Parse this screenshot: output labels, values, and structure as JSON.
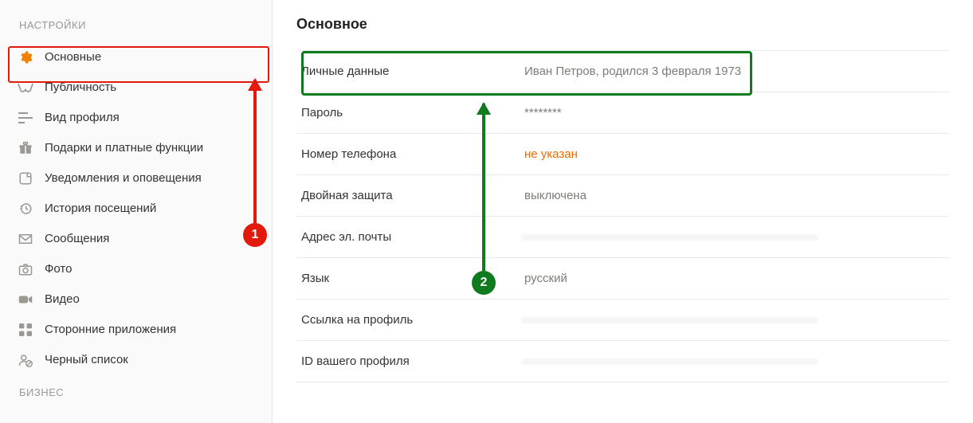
{
  "sidebar": {
    "heading1": "НАСТРОЙКИ",
    "heading2": "БИЗНЕС",
    "items": [
      {
        "label": "Основные",
        "icon": "gear"
      },
      {
        "label": "Публичность",
        "icon": "glasses"
      },
      {
        "label": "Вид профиля",
        "icon": "list"
      },
      {
        "label": "Подарки и платные функции",
        "icon": "gift"
      },
      {
        "label": "Уведомления и оповещения",
        "icon": "notify"
      },
      {
        "label": "История посещений",
        "icon": "history"
      },
      {
        "label": "Сообщения",
        "icon": "mail"
      },
      {
        "label": "Фото",
        "icon": "camera"
      },
      {
        "label": "Видео",
        "icon": "video"
      },
      {
        "label": "Сторонние приложения",
        "icon": "apps"
      },
      {
        "label": "Черный список",
        "icon": "blacklist"
      }
    ]
  },
  "main": {
    "title": "Основное",
    "rows": [
      {
        "label": "Личные данные",
        "value": "Иван Петров, родился 3 февраля 1973"
      },
      {
        "label": "Пароль",
        "value": "********"
      },
      {
        "label": "Номер телефона",
        "value": "не указан"
      },
      {
        "label": "Двойная защита",
        "value": "выключена"
      },
      {
        "label": "Адрес эл. почты",
        "value": " "
      },
      {
        "label": "Язык",
        "value": "русский"
      },
      {
        "label": "Ссылка на профиль",
        "value": " "
      },
      {
        "label": "ID вашего профиля",
        "value": " "
      }
    ]
  },
  "annotations": {
    "badge1": "1",
    "badge2": "2"
  }
}
